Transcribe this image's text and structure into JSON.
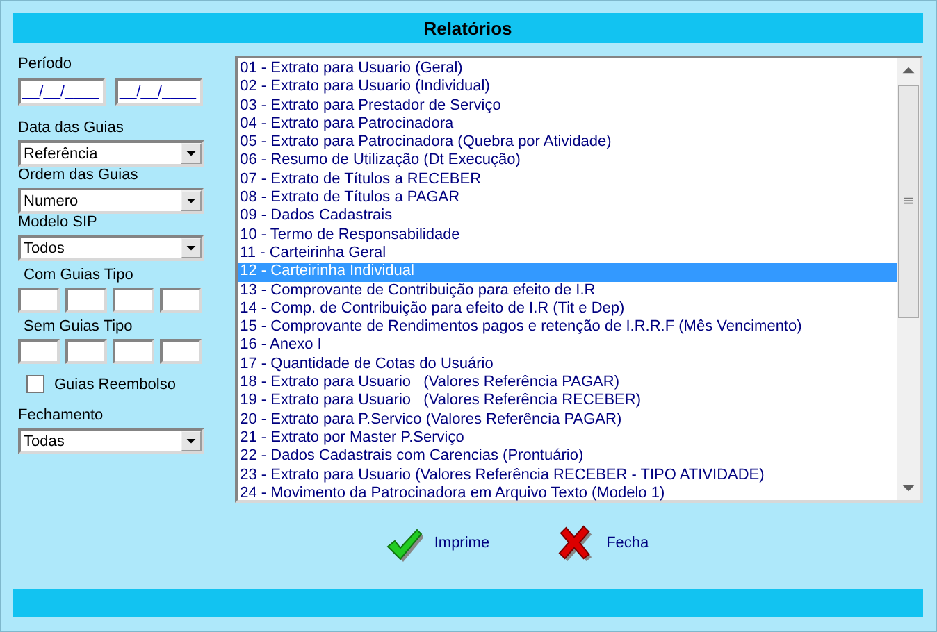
{
  "title": "Relatórios",
  "periodo": {
    "label": "Período",
    "fields": [
      {
        "value": "__/__/____"
      },
      {
        "value": "__/__/____"
      }
    ]
  },
  "data_das_guias": {
    "label": "Data das Guias",
    "value": "Referência"
  },
  "ordem_das_guias": {
    "label": "Ordem das Guias",
    "value": "Numero"
  },
  "modelo_sip": {
    "label": "Modelo SIP",
    "value": "Todos"
  },
  "com_guias_tipo": {
    "label": "Com Guias Tipo",
    "fields": [
      {
        "kind": "text"
      },
      {
        "kind": "text"
      },
      {
        "kind": "text"
      },
      {
        "kind": "text"
      }
    ]
  },
  "sem_guias_tipo": {
    "label": "Sem Guias Tipo",
    "fields": [
      {
        "kind": "text"
      },
      {
        "kind": "text"
      },
      {
        "kind": "text"
      },
      {
        "kind": "text"
      }
    ]
  },
  "guias_reembolso": {
    "label": "Guias Reembolso",
    "checked": false
  },
  "fechamento": {
    "label": "Fechamento",
    "value": "Todas"
  },
  "reports": [
    {
      "label": "01 - Extrato para Usuario (Geral)",
      "selected": false
    },
    {
      "label": "02 - Extrato para Usuario (Individual)",
      "selected": false
    },
    {
      "label": "03 - Extrato para Prestador de Serviço",
      "selected": false
    },
    {
      "label": "04 - Extrato para Patrocinadora",
      "selected": false
    },
    {
      "label": "05 - Extrato para Patrocinadora (Quebra por Atividade)",
      "selected": false
    },
    {
      "label": "06 - Resumo de Utilização (Dt Execução)",
      "selected": false
    },
    {
      "label": "07 - Extrato de Títulos a RECEBER",
      "selected": false
    },
    {
      "label": "08 - Extrato de Títulos a PAGAR",
      "selected": false
    },
    {
      "label": "09 - Dados Cadastrais",
      "selected": false
    },
    {
      "label": "10 - Termo de Responsabilidade",
      "selected": false
    },
    {
      "label": "11 - Carteirinha Geral",
      "selected": false
    },
    {
      "label": "12 - Carteirinha Individual",
      "selected": true
    },
    {
      "label": "13 - Comprovante de Contribuição para efeito de I.R",
      "selected": false
    },
    {
      "label": "14 - Comp. de Contribuição para efeito de I.R (Tit e Dep)",
      "selected": false
    },
    {
      "label": "15 - Comprovante de Rendimentos pagos e retenção de I.R.R.F (Mês Vencimento)",
      "selected": false
    },
    {
      "label": "16 - Anexo I",
      "selected": false
    },
    {
      "label": "17 - Quantidade de Cotas do Usuário",
      "selected": false
    },
    {
      "label": "18 - Extrato para Usuario   (Valores Referência PAGAR)",
      "selected": false
    },
    {
      "label": "19 - Extrato para Usuario   (Valores Referência RECEBER)",
      "selected": false
    },
    {
      "label": "20 - Extrato para P.Servico (Valores Referência PAGAR)",
      "selected": false
    },
    {
      "label": "21 - Extrato por Master P.Serviço",
      "selected": false
    },
    {
      "label": "22 - Dados Cadastrais com Carencias (Prontuário)",
      "selected": false
    },
    {
      "label": "23 - Extrato para Usuario (Valores Referência RECEBER - TIPO ATIVIDADE)",
      "selected": false
    },
    {
      "label": "24 - Movimento da Patrocinadora em Arquivo Texto (Modelo 1)",
      "selected": false
    }
  ],
  "buttons": [
    {
      "label": "Imprime",
      "kind": "print"
    },
    {
      "label": "Fecha",
      "kind": "close"
    }
  ]
}
